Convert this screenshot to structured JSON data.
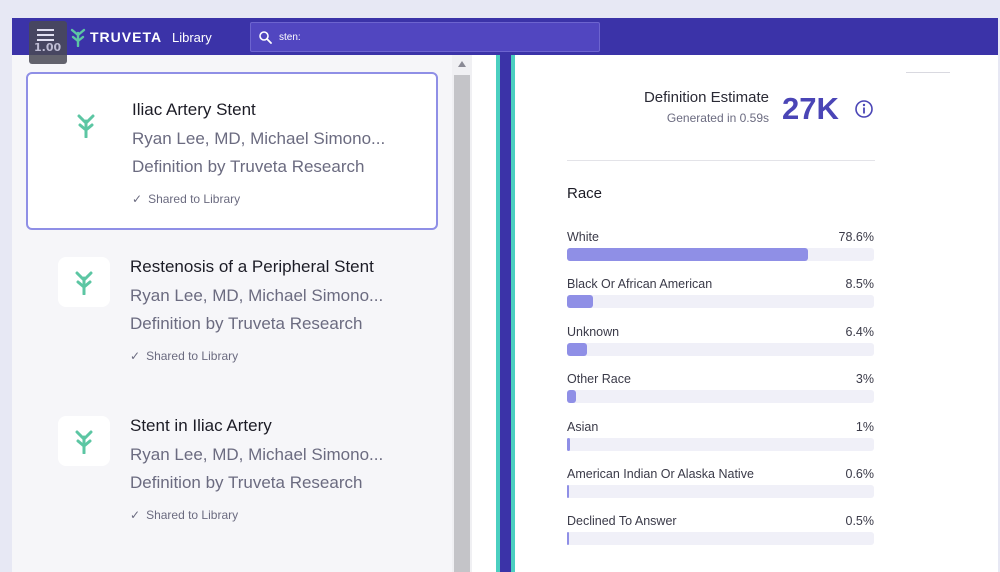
{
  "header": {
    "zoom": "1.00",
    "brand": "TRUVETA",
    "nav_library": "Library",
    "search_value": "sten:"
  },
  "results": [
    {
      "title": "Iliac Artery Stent",
      "authors": "Ryan Lee, MD, Michael Simono...",
      "definition_by": "Definition by Truveta Research",
      "shared": "Shared to Library",
      "selected": true
    },
    {
      "title": "Restenosis of a Peripheral Stent",
      "authors": "Ryan Lee, MD, Michael Simono...",
      "definition_by": "Definition by Truveta Research",
      "shared": "Shared to Library",
      "selected": false
    },
    {
      "title": "Stent in Iliac Artery",
      "authors": "Ryan Lee, MD, Michael Simono...",
      "definition_by": "Definition by Truveta Research",
      "shared": "Shared to Library",
      "selected": false
    }
  ],
  "estimate": {
    "label": "Definition Estimate",
    "generated": "Generated in 0.59s",
    "value": "27K"
  },
  "race": {
    "title": "Race",
    "items": [
      {
        "label": "White",
        "pct_text": "78.6%",
        "fraction": 0.786
      },
      {
        "label": "Black Or African American",
        "pct_text": "8.5%",
        "fraction": 0.085
      },
      {
        "label": "Unknown",
        "pct_text": "6.4%",
        "fraction": 0.064
      },
      {
        "label": "Other Race",
        "pct_text": "3%",
        "fraction": 0.03
      },
      {
        "label": "Asian",
        "pct_text": "1%",
        "fraction": 0.01
      },
      {
        "label": "American Indian Or Alaska Native",
        "pct_text": "0.6%",
        "fraction": 0.006
      },
      {
        "label": "Declined To Answer",
        "pct_text": "0.5%",
        "fraction": 0.005
      }
    ]
  },
  "colors": {
    "topbar": "#3b33a8",
    "accent": "#4a45b6",
    "bar_fill": "#8f8fe6",
    "teal": "#4bcfc0",
    "logo_green": "#5cc6a3"
  }
}
